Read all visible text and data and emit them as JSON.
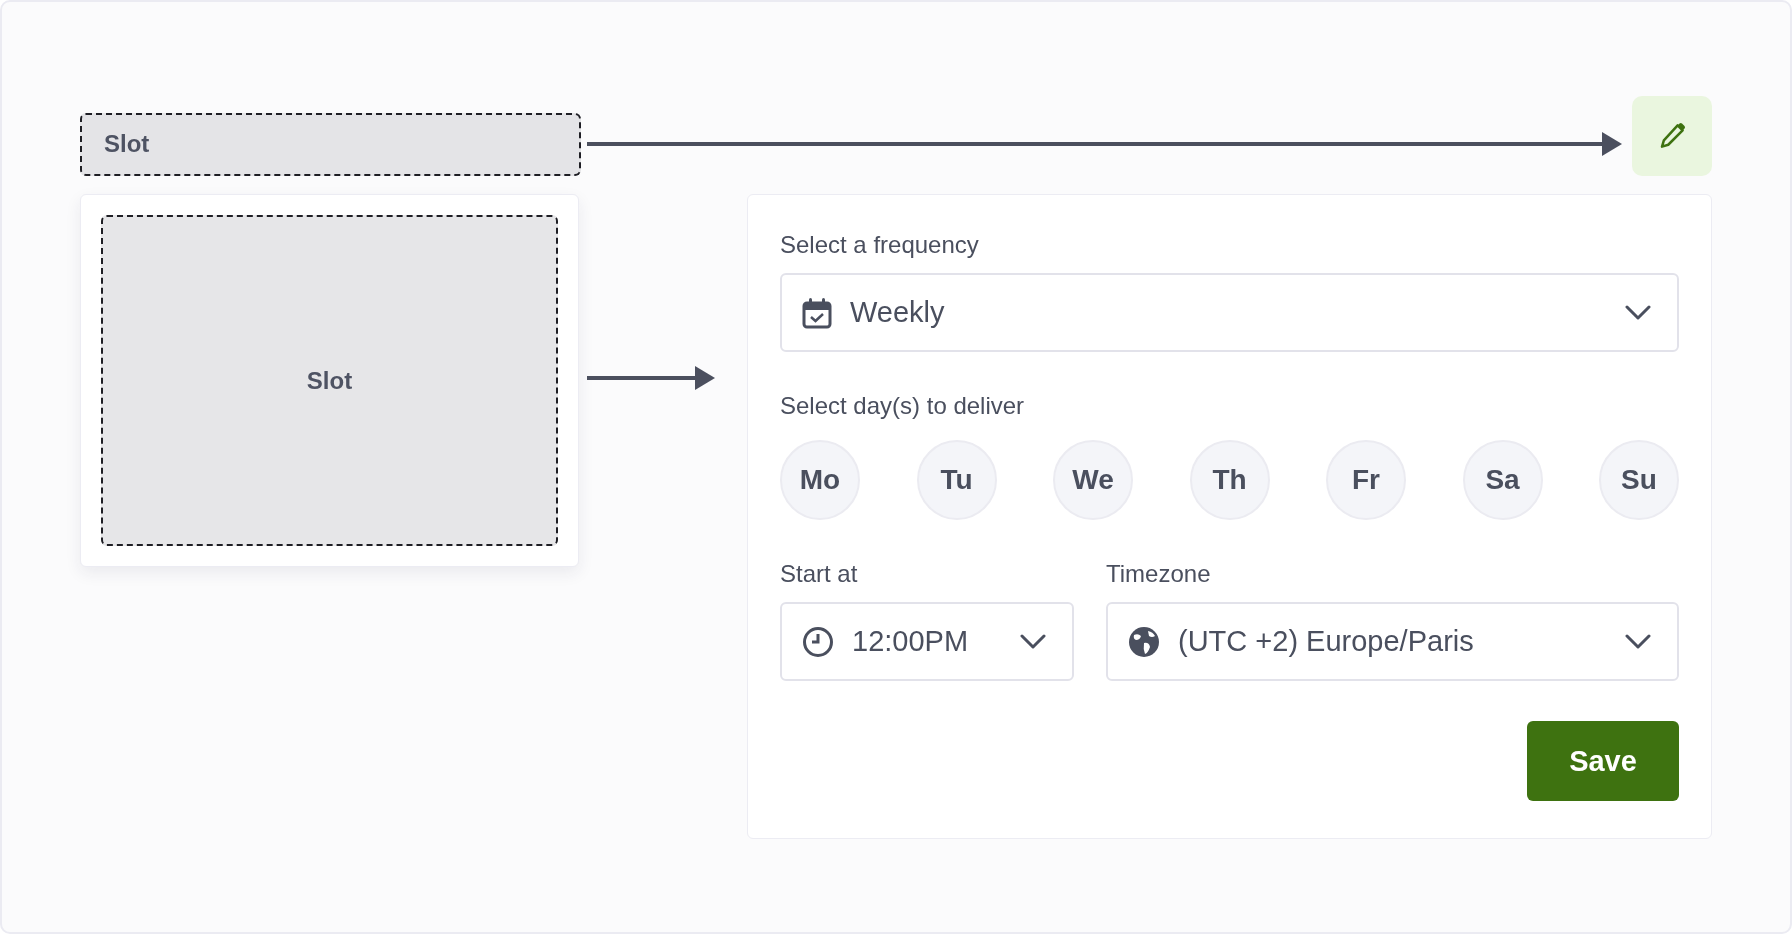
{
  "top_slot": {
    "label": "Slot"
  },
  "card_slot": {
    "label": "Slot"
  },
  "form": {
    "frequency": {
      "label": "Select a frequency",
      "value": "Weekly"
    },
    "days": {
      "label": "Select day(s) to deliver",
      "items": [
        {
          "label": "Mo",
          "selected": false
        },
        {
          "label": "Tu",
          "selected": false
        },
        {
          "label": "We",
          "selected": false
        },
        {
          "label": "Th",
          "selected": false
        },
        {
          "label": "Fr",
          "selected": false
        },
        {
          "label": "Sa",
          "selected": false
        },
        {
          "label": "Su",
          "selected": false
        }
      ]
    },
    "start_at": {
      "label": "Start at",
      "value": "12:00PM"
    },
    "timezone": {
      "label": "Timezone",
      "value": "(UTC +2) Europe/Paris"
    },
    "save_button": "Save"
  }
}
